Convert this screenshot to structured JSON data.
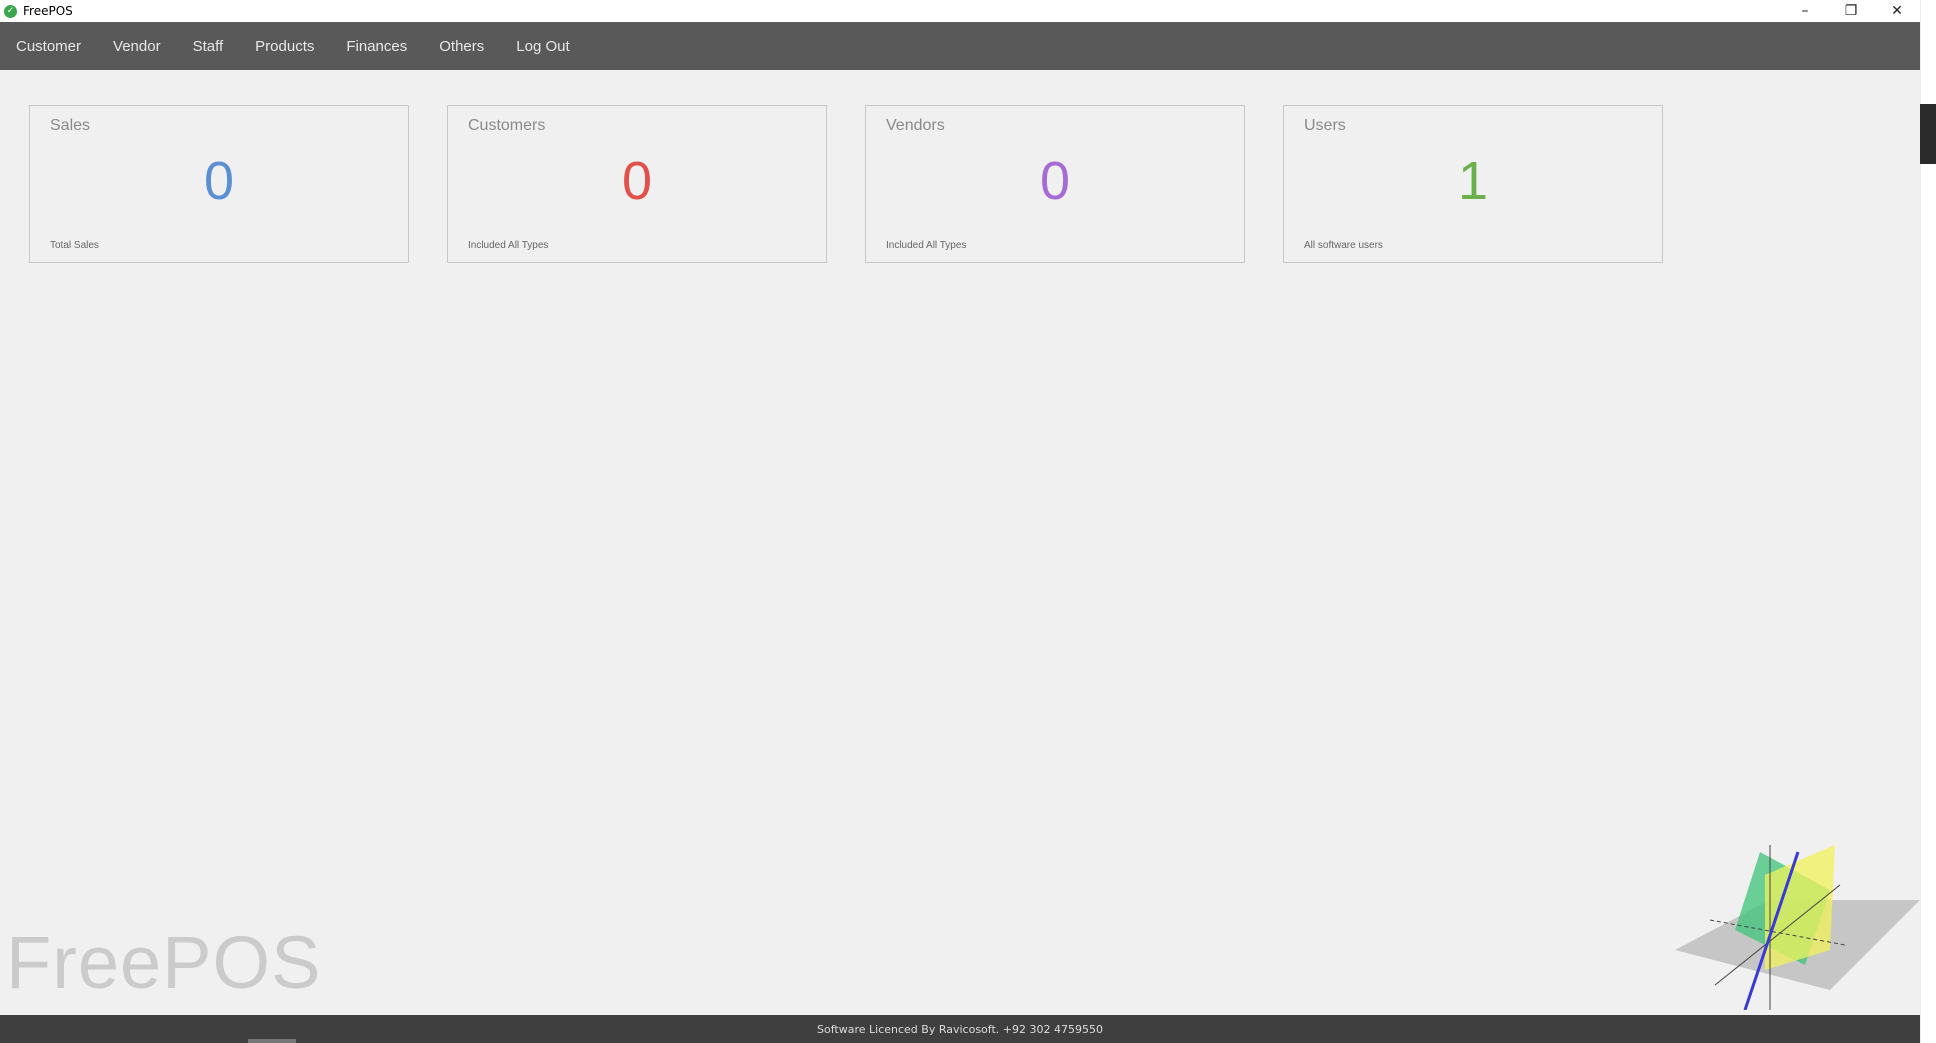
{
  "window": {
    "title": "FreePOS",
    "minimize_glyph": "–",
    "restore_glyph": "❐",
    "close_glyph": "✕",
    "app_icon": "check-icon"
  },
  "menu": {
    "items": [
      {
        "label": "Customer"
      },
      {
        "label": "Vendor"
      },
      {
        "label": "Staff"
      },
      {
        "label": "Products"
      },
      {
        "label": "Finances"
      },
      {
        "label": "Others"
      },
      {
        "label": "Log Out"
      }
    ]
  },
  "cards": [
    {
      "title": "Sales",
      "value": "0",
      "subtitle": "Total Sales",
      "color": "#5b8fd4"
    },
    {
      "title": "Customers",
      "value": "0",
      "subtitle": "Included All Types",
      "color": "#e2504a"
    },
    {
      "title": "Vendors",
      "value": "0",
      "subtitle": "Included All Types",
      "color": "#a56bd6"
    },
    {
      "title": "Users",
      "value": "1",
      "subtitle": "All software users",
      "color": "#6ab04c"
    }
  ],
  "watermark": "FreePOS",
  "footer": {
    "text": "Software Licenced By Ravicosoft. +92 302 4759550"
  },
  "colors": {
    "menubar": "#595959",
    "footer": "#3f3f3f",
    "background": "#f0f0f0"
  }
}
